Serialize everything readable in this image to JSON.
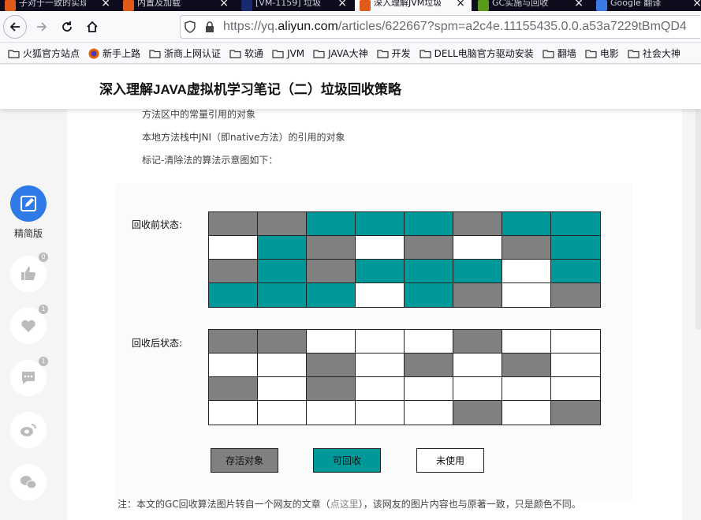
{
  "browser": {
    "tabs": [
      {
        "title": "子对于一致的实现",
        "active": false,
        "color": "#e05a1a"
      },
      {
        "title": "内置及加载",
        "active": false,
        "color": "#e05a1a"
      },
      {
        "title": "[VM-1159] 垃圾",
        "active": false,
        "color": "#1a2a6e"
      },
      {
        "title": "深入理解JVM垃圾",
        "active": true,
        "color": "#e05a1a"
      },
      {
        "title": "GC实施与回收",
        "active": false,
        "color": "#5a9a1a"
      },
      {
        "title": "Google 翻译",
        "active": false,
        "color": "#3a7ae6"
      }
    ],
    "url_prefix": "https://yq.",
    "url_host": "aliyun.com",
    "url_path": "/articles/622667?spm=a2c4e.11155435.0.0.a53a7229tBmQD4",
    "bookmarks": [
      "火狐官方站点",
      "新手上路",
      "浙商上网认证",
      "软通",
      "JVM",
      "JAVA大神",
      "开发",
      "DELL电脑官方驱动安装",
      "翻墙",
      "电影",
      "社会大神"
    ]
  },
  "article": {
    "title": "深入理解JAVA虚拟机学习笔记（二）垃圾回收策略"
  },
  "sidebar": {
    "simple_label": "精简版",
    "like_count": "0",
    "fav_count": "1",
    "comment_count": "1"
  },
  "content": {
    "lines": [
      "方法区中的常量引用的对象",
      "本地方法栈中JNI（即native方法）的引用的对象",
      "标记-清除法的算法示意图如下："
    ],
    "before_label": "回收前状态:",
    "after_label": "回收后状态:",
    "before_grid": [
      [
        "alive",
        "alive",
        "collect",
        "collect",
        "collect",
        "alive",
        "collect",
        "collect"
      ],
      [
        "free",
        "collect",
        "alive",
        "free",
        "alive",
        "free",
        "alive",
        "collect"
      ],
      [
        "alive",
        "collect",
        "alive",
        "collect",
        "collect",
        "collect",
        "free",
        "collect"
      ],
      [
        "collect",
        "collect",
        "collect",
        "free",
        "collect",
        "alive",
        "free",
        "alive"
      ]
    ],
    "after_grid": [
      [
        "alive",
        "alive",
        "free",
        "free",
        "free",
        "alive",
        "free",
        "free"
      ],
      [
        "free",
        "free",
        "alive",
        "free",
        "alive",
        "free",
        "alive",
        "free"
      ],
      [
        "alive",
        "free",
        "alive",
        "free",
        "free",
        "free",
        "free",
        "free"
      ],
      [
        "free",
        "free",
        "free",
        "free",
        "free",
        "alive",
        "free",
        "alive"
      ]
    ],
    "legend": {
      "alive": "存活对象",
      "collect": "可回收",
      "free": "未使用"
    },
    "colors": {
      "alive": "#808080",
      "collect": "#009999",
      "free": "#ffffff"
    },
    "footnote_a": "注：本文的GC回收算法图片转自一个网友的文章（",
    "footnote_link": "点这里",
    "footnote_b": "），该网友的图片内容也与原著一致，只是颜色不同。"
  }
}
